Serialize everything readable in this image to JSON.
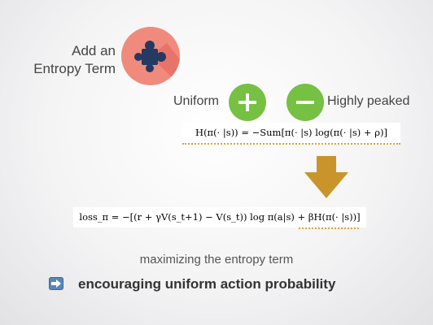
{
  "heading": {
    "line1": "Add an",
    "line2": "Entropy Term"
  },
  "options": {
    "left_label": "Uniform",
    "right_label": "Highly peaked"
  },
  "formulas": {
    "entropy": "H(π(· |s)) = −Sum[π(· |s) log(π(· |s) + ρ)]",
    "loss": "loss_π = −[(r + γV(s_t+1) − V(s_t)) log π(a|s) + βH(π(· |s))]"
  },
  "caption": "maximizing the entropy term",
  "conclusion": "encouraging uniform action probability",
  "colors": {
    "puzzle_circle": "#f08a7d",
    "puzzle_piece": "#243a63",
    "button_green": "#76c043",
    "arrow_gold": "#c9952b",
    "underline": "#d9a23b"
  },
  "icons": [
    "puzzle-icon",
    "plus-icon",
    "minus-icon",
    "arrow-right-icon"
  ]
}
